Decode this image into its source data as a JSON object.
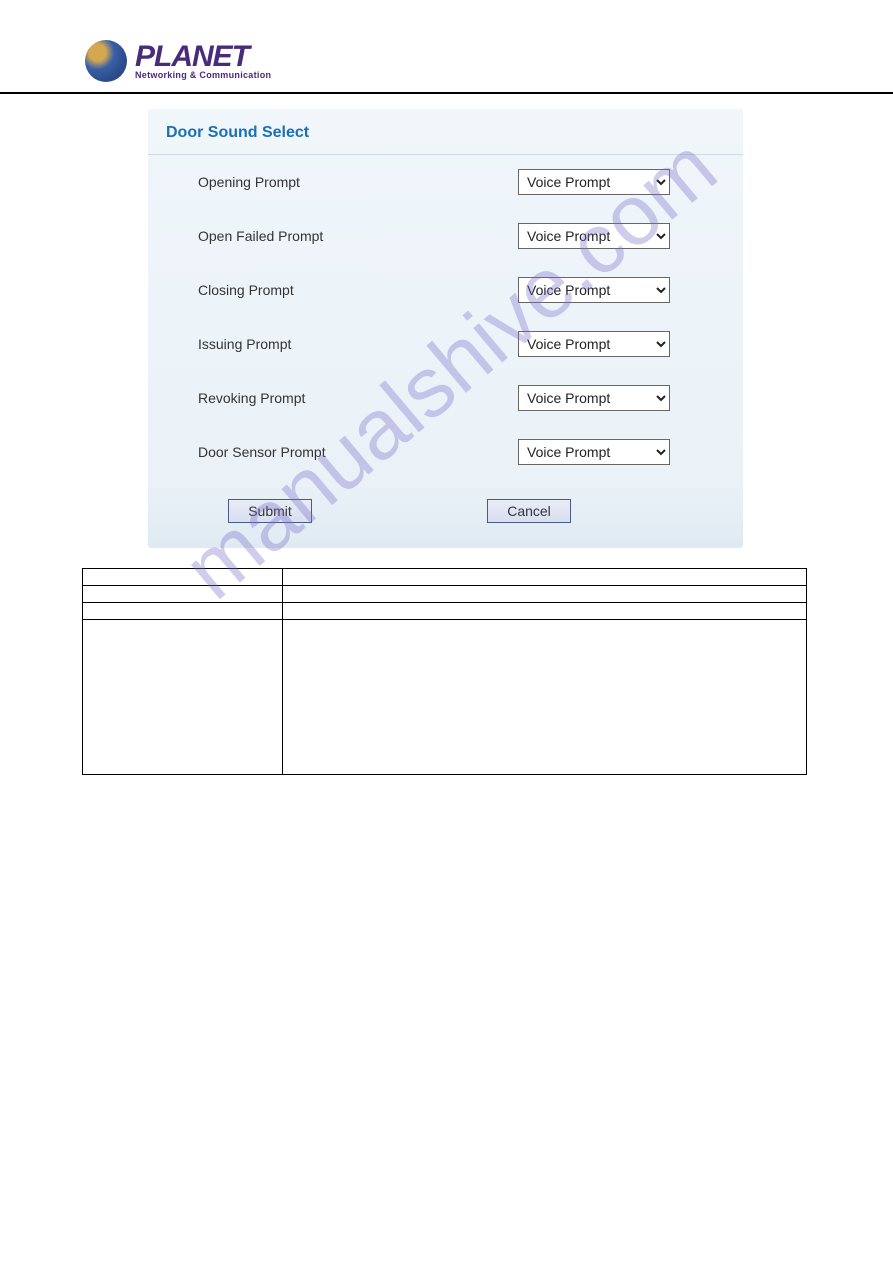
{
  "header": {
    "logo_main": "PLANET",
    "logo_sub": "Networking & Communication"
  },
  "panel": {
    "title": "Door Sound Select",
    "rows": [
      {
        "label": "Opening Prompt",
        "value": "Voice Prompt"
      },
      {
        "label": "Open Failed Prompt",
        "value": "Voice Prompt"
      },
      {
        "label": "Closing Prompt",
        "value": "Voice Prompt"
      },
      {
        "label": "Issuing Prompt",
        "value": "Voice Prompt"
      },
      {
        "label": "Revoking Prompt",
        "value": "Voice Prompt"
      },
      {
        "label": "Door Sensor Prompt",
        "value": "Voice Prompt"
      }
    ],
    "buttons": {
      "submit": "Submit",
      "cancel": "Cancel"
    }
  },
  "table": {
    "rows": [
      {
        "c0": "",
        "c1": ""
      },
      {
        "c0": "",
        "c1": ""
      },
      {
        "c0": "",
        "c1": ""
      },
      {
        "c0": "",
        "c1": ""
      }
    ]
  },
  "watermark": "manualshive.com"
}
